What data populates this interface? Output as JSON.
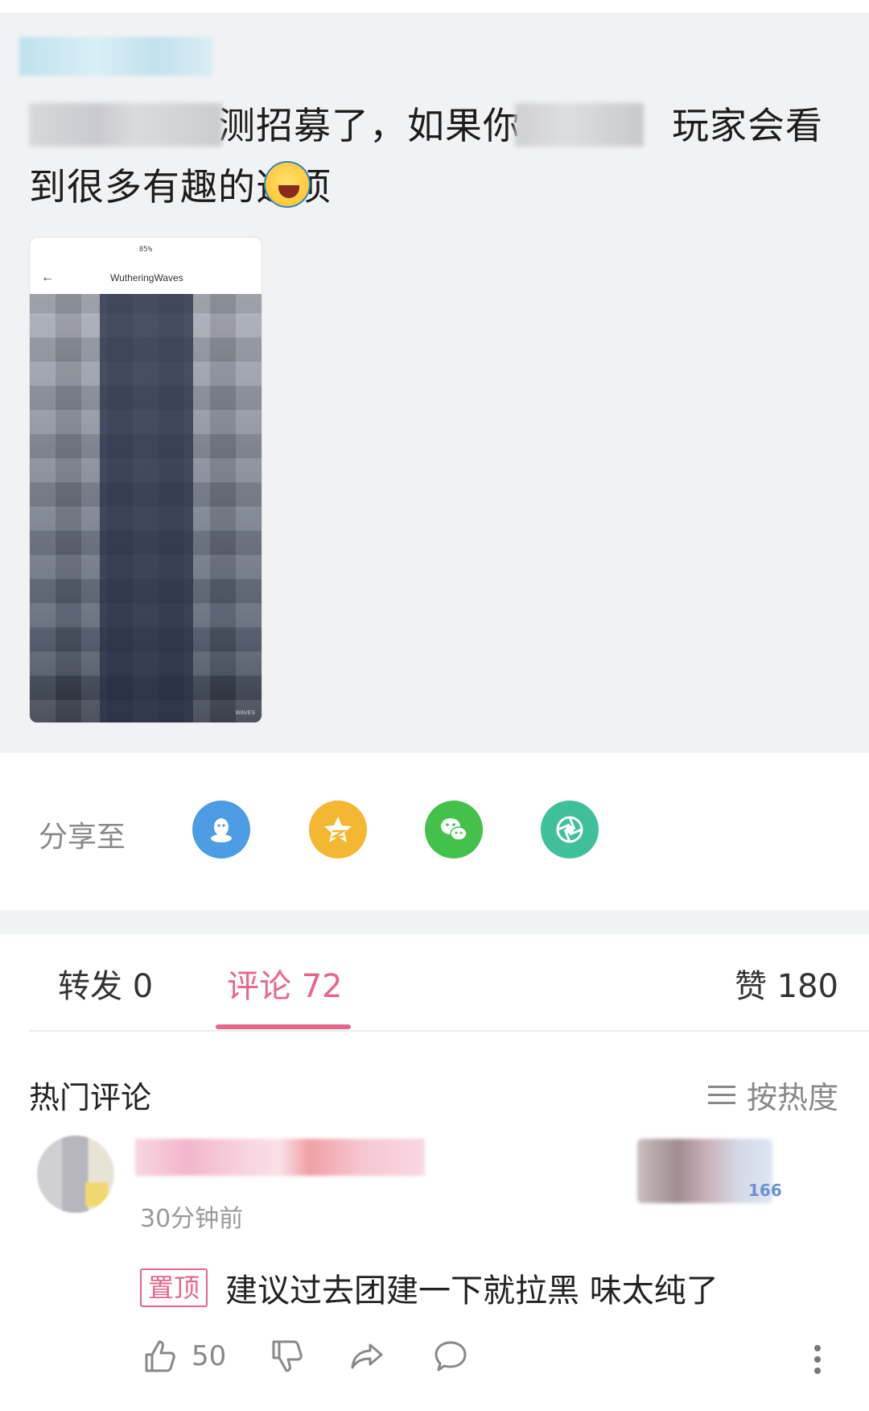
{
  "post": {
    "text": "　　　　　测招募了，如果你是　　　玩家会看到很多有趣的选项",
    "image": {
      "header_title": "WutheringWaves",
      "footer_text": "WAVES",
      "status_text": "85%"
    }
  },
  "share": {
    "label": "分享至",
    "targets": [
      {
        "name": "QQ",
        "icon": "qq-icon",
        "color": "#4c9be3"
      },
      {
        "name": "QQ空间",
        "icon": "qzone-star-icon",
        "color": "#f3b731"
      },
      {
        "name": "微信",
        "icon": "wechat-icon",
        "color": "#43c14a"
      },
      {
        "name": "朋友圈",
        "icon": "moments-aperture-icon",
        "color": "#3fbf9a"
      }
    ]
  },
  "tabs": {
    "forward": "转发 0",
    "comments": "评论 72",
    "likes": "赞 180",
    "active_color": "#e5668b"
  },
  "comments_section": {
    "title": "热门评论",
    "sort_label": "按热度",
    "items": [
      {
        "time": "30分钟前",
        "badge_number": "166",
        "pinned_label": "置顶",
        "text": "建议过去团建一下就拉黑  味太纯了",
        "like_count": "50"
      }
    ]
  }
}
